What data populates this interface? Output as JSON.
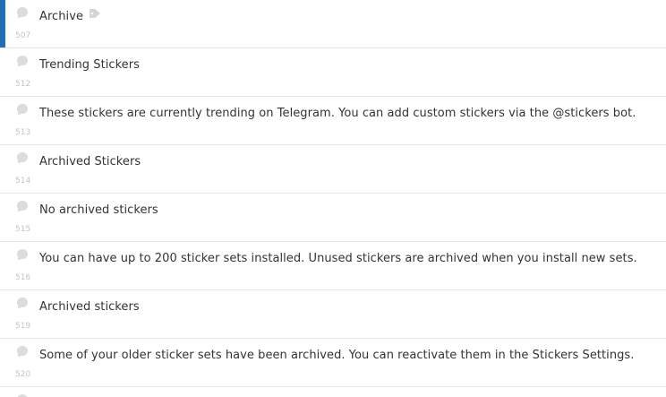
{
  "rows": [
    {
      "text": "Archive",
      "id": "507",
      "icon": "tag-icon",
      "selected": true
    },
    {
      "text": "Trending Stickers",
      "id": "512"
    },
    {
      "text": "These stickers are currently trending on Telegram. You can add custom stickers via the @stickers bot.",
      "id": "513"
    },
    {
      "text": "Archived Stickers",
      "id": "514"
    },
    {
      "text": "No archived stickers",
      "id": "515"
    },
    {
      "text": "You can have up to 200 sticker sets installed. Unused stickers are archived when you install new sets.",
      "id": "516"
    },
    {
      "text": "Archived stickers",
      "id": "519"
    },
    {
      "text": "Some of your older sticker sets have been archived. You can reactivate them in the Stickers Settings.",
      "id": "520"
    }
  ],
  "colors": {
    "accent": "#1f6fb2",
    "text": "#333333",
    "row_number": "#c4c4c4",
    "divider": "#e6e6e6"
  }
}
